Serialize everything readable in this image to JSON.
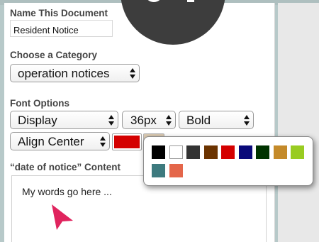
{
  "document_name": {
    "label": "Name This Document",
    "value": "Resident Notice"
  },
  "category": {
    "label": "Choose a Category",
    "selected": "operation notices"
  },
  "font_options": {
    "label": "Font Options",
    "font_family": "Display",
    "font_size": "36px",
    "font_weight": "Bold",
    "alignment": "Align Center",
    "selected_color": "#d40000"
  },
  "content_field": {
    "label": "“date of notice” Content",
    "value": "My words go here ..."
  },
  "color_palette": {
    "swatches": [
      {
        "name": "black",
        "color": "#000000"
      },
      {
        "name": "white",
        "color": "#ffffff"
      },
      {
        "name": "charcoal",
        "color": "#333333"
      },
      {
        "name": "brown",
        "color": "#6b3300"
      },
      {
        "name": "red",
        "color": "#d40000"
      },
      {
        "name": "navy",
        "color": "#0a0a7a"
      },
      {
        "name": "dark-green",
        "color": "#003300"
      },
      {
        "name": "ochre",
        "color": "#c48a2a"
      },
      {
        "name": "lime",
        "color": "#99cc22"
      },
      {
        "name": "teal",
        "color": "#3d7a7e"
      },
      {
        "name": "coral",
        "color": "#e4664a"
      }
    ]
  },
  "icons": {
    "pointer": "pointer-cursor-icon",
    "select_arrows": "select-arrows-icon"
  },
  "colors": {
    "background": "#b7c9c9",
    "panel": "#ffffff",
    "cursor": "#e0245e",
    "overlay_circle": "#3d3d3d"
  }
}
